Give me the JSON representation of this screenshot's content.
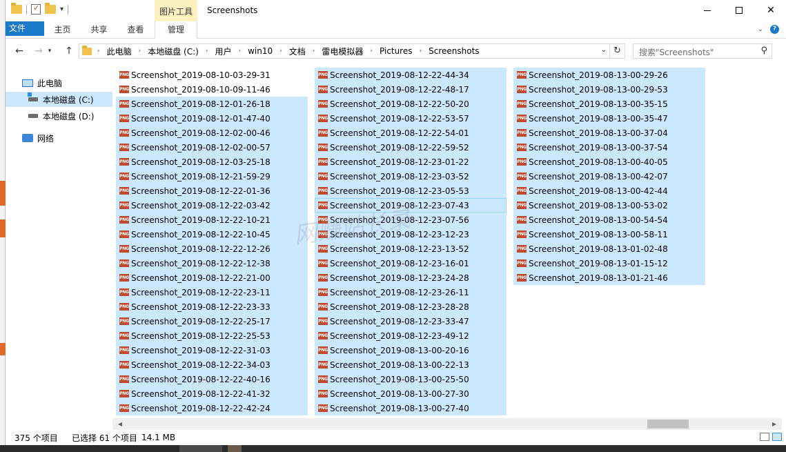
{
  "window": {
    "title": "Screenshots",
    "context_tab_header": "图片工具",
    "controls": {
      "minimize": "minimize",
      "maximize": "maximize",
      "close": "✕"
    }
  },
  "ribbon": {
    "tabs": [
      "文件",
      "主页",
      "共享",
      "查看",
      "管理"
    ]
  },
  "address": {
    "crumbs": [
      "此电脑",
      "本地磁盘 (C:)",
      "用户",
      "win10",
      "文档",
      "雷电模拟器",
      "Pictures",
      "Screenshots"
    ]
  },
  "search": {
    "placeholder": "搜索\"Screenshots\""
  },
  "nav": {
    "items": [
      "此电脑",
      "本地磁盘 (C:)",
      "本地磁盘 (D:)",
      "网络"
    ]
  },
  "files": {
    "col1": [
      "Screenshot_2019-08-10-03-29-31",
      "Screenshot_2019-08-10-09-11-46",
      "Screenshot_2019-08-12-01-26-18",
      "Screenshot_2019-08-12-01-47-40",
      "Screenshot_2019-08-12-02-00-46",
      "Screenshot_2019-08-12-02-00-57",
      "Screenshot_2019-08-12-03-25-18",
      "Screenshot_2019-08-12-21-59-29",
      "Screenshot_2019-08-12-22-01-36",
      "Screenshot_2019-08-12-22-03-42",
      "Screenshot_2019-08-12-22-10-21",
      "Screenshot_2019-08-12-22-10-45",
      "Screenshot_2019-08-12-22-12-26",
      "Screenshot_2019-08-12-22-12-38",
      "Screenshot_2019-08-12-22-21-00",
      "Screenshot_2019-08-12-22-23-11",
      "Screenshot_2019-08-12-22-23-33",
      "Screenshot_2019-08-12-22-25-17",
      "Screenshot_2019-08-12-22-25-53",
      "Screenshot_2019-08-12-22-31-03",
      "Screenshot_2019-08-12-22-34-03",
      "Screenshot_2019-08-12-22-40-16",
      "Screenshot_2019-08-12-22-41-32",
      "Screenshot_2019-08-12-22-42-24"
    ],
    "col2": [
      "Screenshot_2019-08-12-22-44-34",
      "Screenshot_2019-08-12-22-48-17",
      "Screenshot_2019-08-12-22-50-20",
      "Screenshot_2019-08-12-22-53-57",
      "Screenshot_2019-08-12-22-54-01",
      "Screenshot_2019-08-12-22-59-52",
      "Screenshot_2019-08-12-23-01-22",
      "Screenshot_2019-08-12-23-03-52",
      "Screenshot_2019-08-12-23-05-53",
      "Screenshot_2019-08-12-23-07-43",
      "Screenshot_2019-08-12-23-07-56",
      "Screenshot_2019-08-12-23-12-23",
      "Screenshot_2019-08-12-23-13-52",
      "Screenshot_2019-08-12-23-16-01",
      "Screenshot_2019-08-12-23-24-28",
      "Screenshot_2019-08-12-23-26-11",
      "Screenshot_2019-08-12-23-28-28",
      "Screenshot_2019-08-12-23-33-47",
      "Screenshot_2019-08-12-23-49-12",
      "Screenshot_2019-08-13-00-20-16",
      "Screenshot_2019-08-13-00-22-13",
      "Screenshot_2019-08-13-00-25-50",
      "Screenshot_2019-08-13-00-27-30",
      "Screenshot_2019-08-13-00-27-40"
    ],
    "col3": [
      "Screenshot_2019-08-13-00-29-26",
      "Screenshot_2019-08-13-00-29-53",
      "Screenshot_2019-08-13-00-35-15",
      "Screenshot_2019-08-13-00-35-47",
      "Screenshot_2019-08-13-00-37-04",
      "Screenshot_2019-08-13-00-37-54",
      "Screenshot_2019-08-13-00-40-05",
      "Screenshot_2019-08-13-00-42-07",
      "Screenshot_2019-08-13-00-42-44",
      "Screenshot_2019-08-13-00-53-02",
      "Screenshot_2019-08-13-00-54-54",
      "Screenshot_2019-08-13-00-58-11",
      "Screenshot_2019-08-13-01-02-48",
      "Screenshot_2019-08-13-01-15-12",
      "Screenshot_2019-08-13-01-21-46"
    ],
    "file_badge": "PNG",
    "unselected_in_col1": 2,
    "focused_col2_index": 9
  },
  "status": {
    "count": "375 个项目",
    "selected": "已选择 61 个项目",
    "size": "14.1 MB"
  },
  "colors": {
    "accent": "#1979ca",
    "selection": "#cce8ff",
    "context_tab": "#fdf3c1",
    "png_badge": "#c24a2c"
  }
}
